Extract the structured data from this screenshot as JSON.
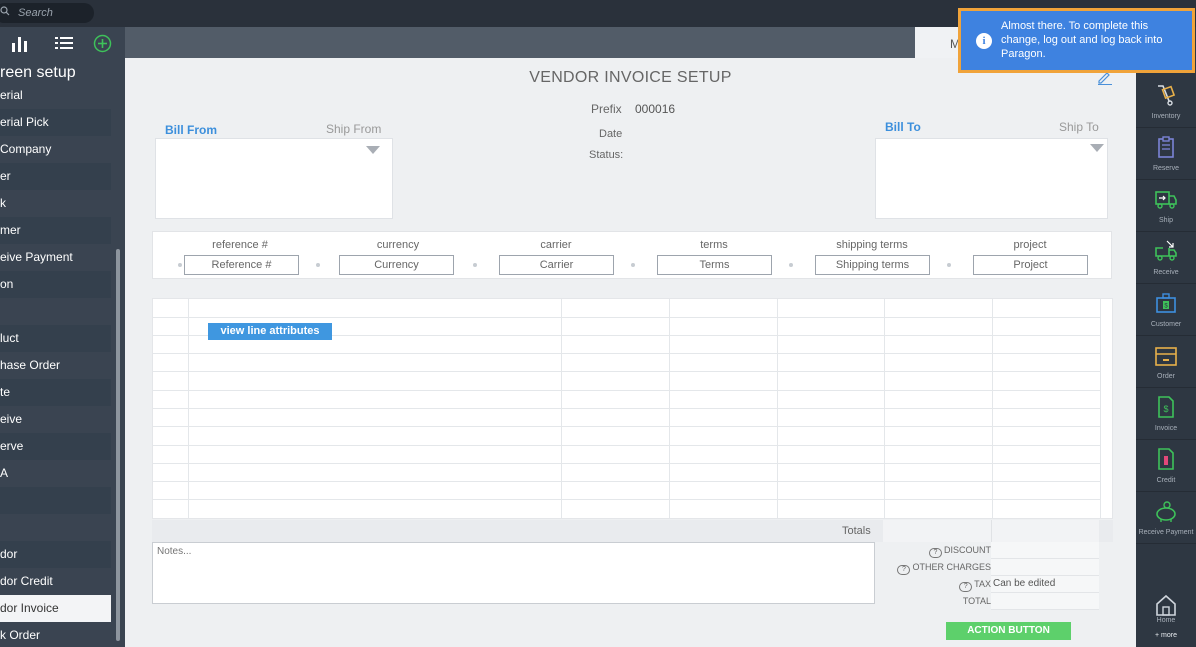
{
  "search": {
    "placeholder": "Search"
  },
  "sidebar": {
    "title": "reen setup",
    "items": [
      {
        "label": "erial"
      },
      {
        "label": "erial Pick"
      },
      {
        "label": " Company"
      },
      {
        "label": "er"
      },
      {
        "label": "k"
      },
      {
        "label": "mer"
      },
      {
        "label": "eive Payment"
      },
      {
        "label": "on"
      },
      {
        "label": ""
      },
      {
        "label": "luct"
      },
      {
        "label": "hase Order"
      },
      {
        "label": "te"
      },
      {
        "label": "eive"
      },
      {
        "label": "erve"
      },
      {
        "label": "A"
      },
      {
        "label": ""
      },
      {
        "label": ""
      },
      {
        "label": "dor"
      },
      {
        "label": "dor Credit"
      },
      {
        "label": "dor Invoice"
      },
      {
        "label": "k Order"
      }
    ]
  },
  "header": {
    "tab_fragment": "M"
  },
  "document": {
    "title": "VENDOR INVOICE SETUP",
    "prefix_label": "Prefix",
    "prefix_value": "000016",
    "date_label": "Date",
    "status_label": "Status:",
    "bill_from": "Bill From",
    "ship_from": "Ship From",
    "bill_to": "Bill To",
    "ship_to": "Ship To"
  },
  "fields": [
    {
      "label": "reference #",
      "value": "Reference #"
    },
    {
      "label": "currency",
      "value": "Currency"
    },
    {
      "label": "carrier",
      "value": "Carrier"
    },
    {
      "label": "terms",
      "value": "Terms"
    },
    {
      "label": "shipping terms",
      "value": "Shipping terms"
    },
    {
      "label": "project",
      "value": "Project"
    }
  ],
  "grid": {
    "view_line_attributes": "view line attributes"
  },
  "totals": {
    "label": "Totals",
    "notes_placeholder": "Notes...",
    "discount": "DISCOUNT",
    "other_charges": "OTHER CHARGES",
    "tax": "TAX",
    "tax_value": "Can be edited",
    "total": "TOTAL",
    "q": "?"
  },
  "action_button": "ACTION BUTTON",
  "rightnav": [
    {
      "label": "Inventory",
      "icon": "dolly-icon",
      "color": "#e8b04a"
    },
    {
      "label": "Reserve",
      "icon": "clipboard-icon",
      "color": "#7b83d6"
    },
    {
      "label": "Ship",
      "icon": "truck-icon",
      "color": "#3ec25a"
    },
    {
      "label": "Receive",
      "icon": "truck-receive-icon",
      "color": "#3ec25a"
    },
    {
      "label": "Customer",
      "icon": "briefcase-icon",
      "color": "#3e8fe0"
    },
    {
      "label": "Order",
      "icon": "box-icon",
      "color": "#e8b04a"
    },
    {
      "label": "Invoice",
      "icon": "invoice-icon",
      "color": "#3ec25a"
    },
    {
      "label": "Credit",
      "icon": "credit-icon",
      "color": "#3ec25a"
    },
    {
      "label": "Receive Payment",
      "icon": "piggy-bank-icon",
      "color": "#3ec25a"
    },
    {
      "label": "Home",
      "icon": "home-icon",
      "color": "#cfd5dc"
    }
  ],
  "more_label": "+ more",
  "toast": {
    "message": "Almost there. To complete this change, log out and log back into Paragon.",
    "icon": "i"
  }
}
